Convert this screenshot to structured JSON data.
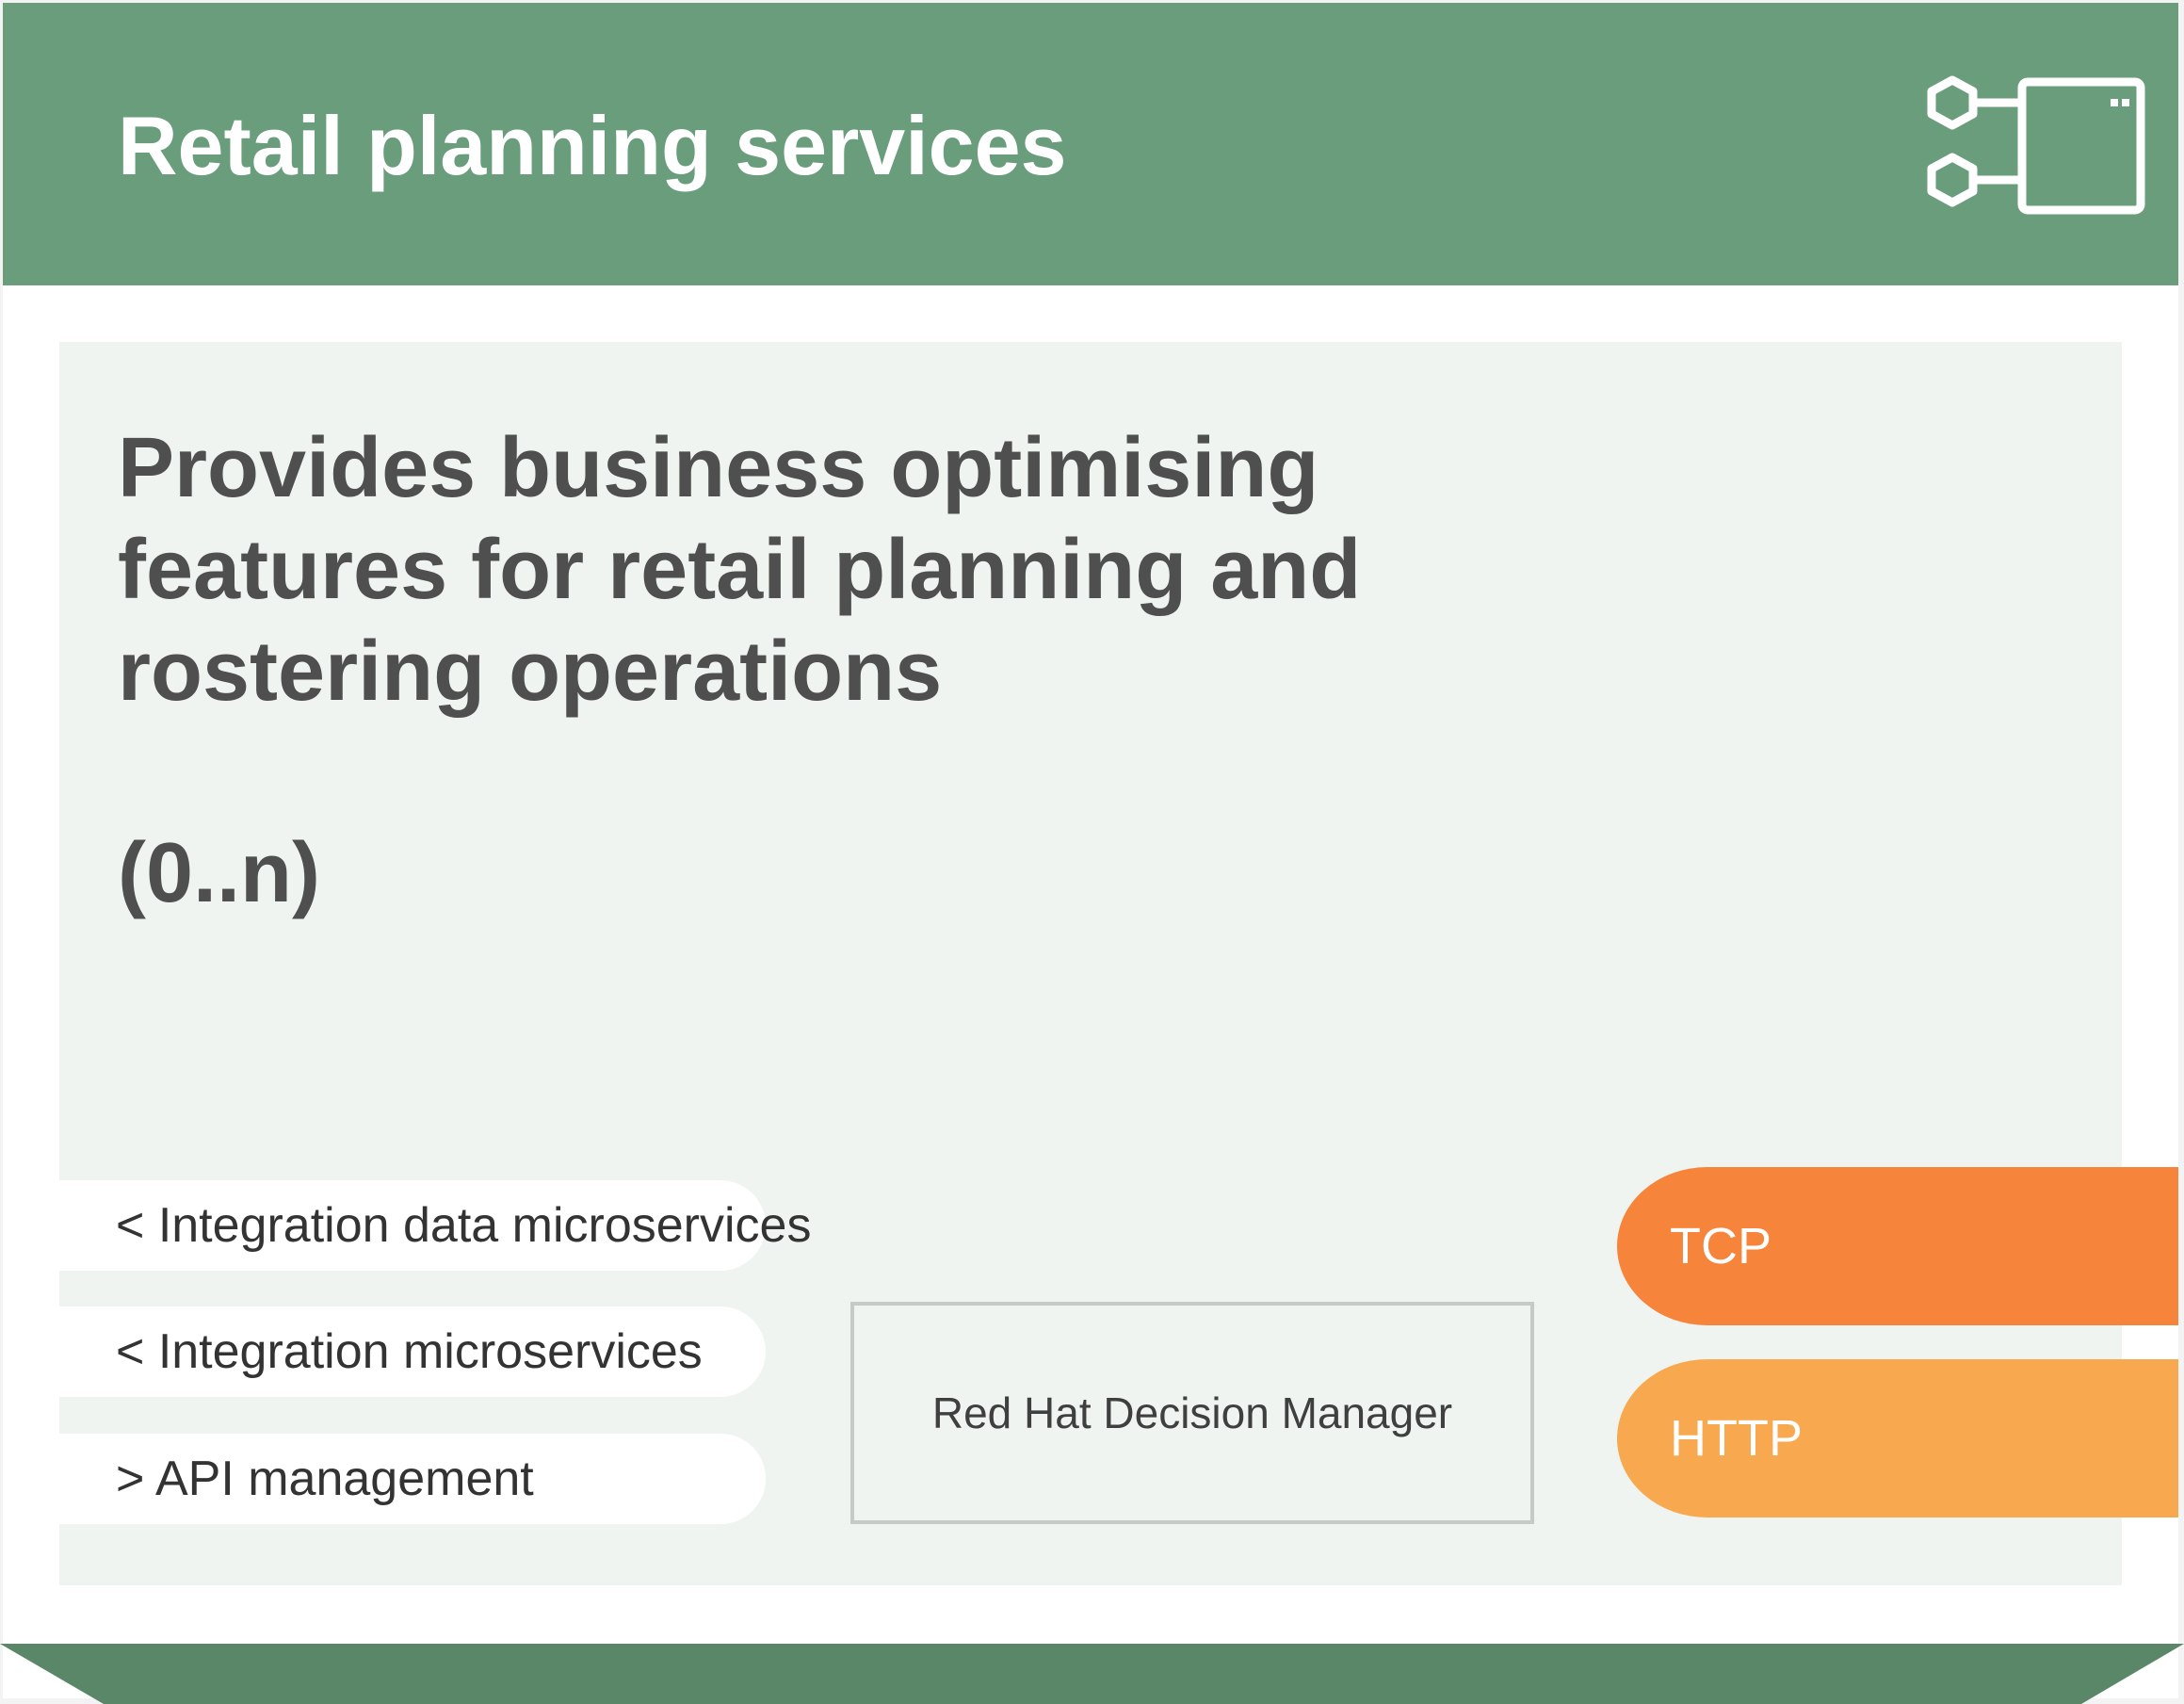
{
  "header": {
    "title": "Retail planning services",
    "icon": "microservice-container-icon",
    "background": "#699d7c"
  },
  "panel": {
    "description": "Provides business optimising\nfeatures for retail planning and\nrostering operations",
    "cardinality": "(0..n)"
  },
  "connections": [
    {
      "label": "< Integration data microservices"
    },
    {
      "label": "< Integration microservices"
    },
    {
      "label": "> API management"
    }
  ],
  "component": {
    "label": "Red Hat Decision Manager"
  },
  "protocols": [
    {
      "label": "TCP",
      "color": "#f6843b"
    },
    {
      "label": "HTTP",
      "color": "#f8a84f"
    }
  ],
  "footer": {
    "color": "#5a8768"
  }
}
